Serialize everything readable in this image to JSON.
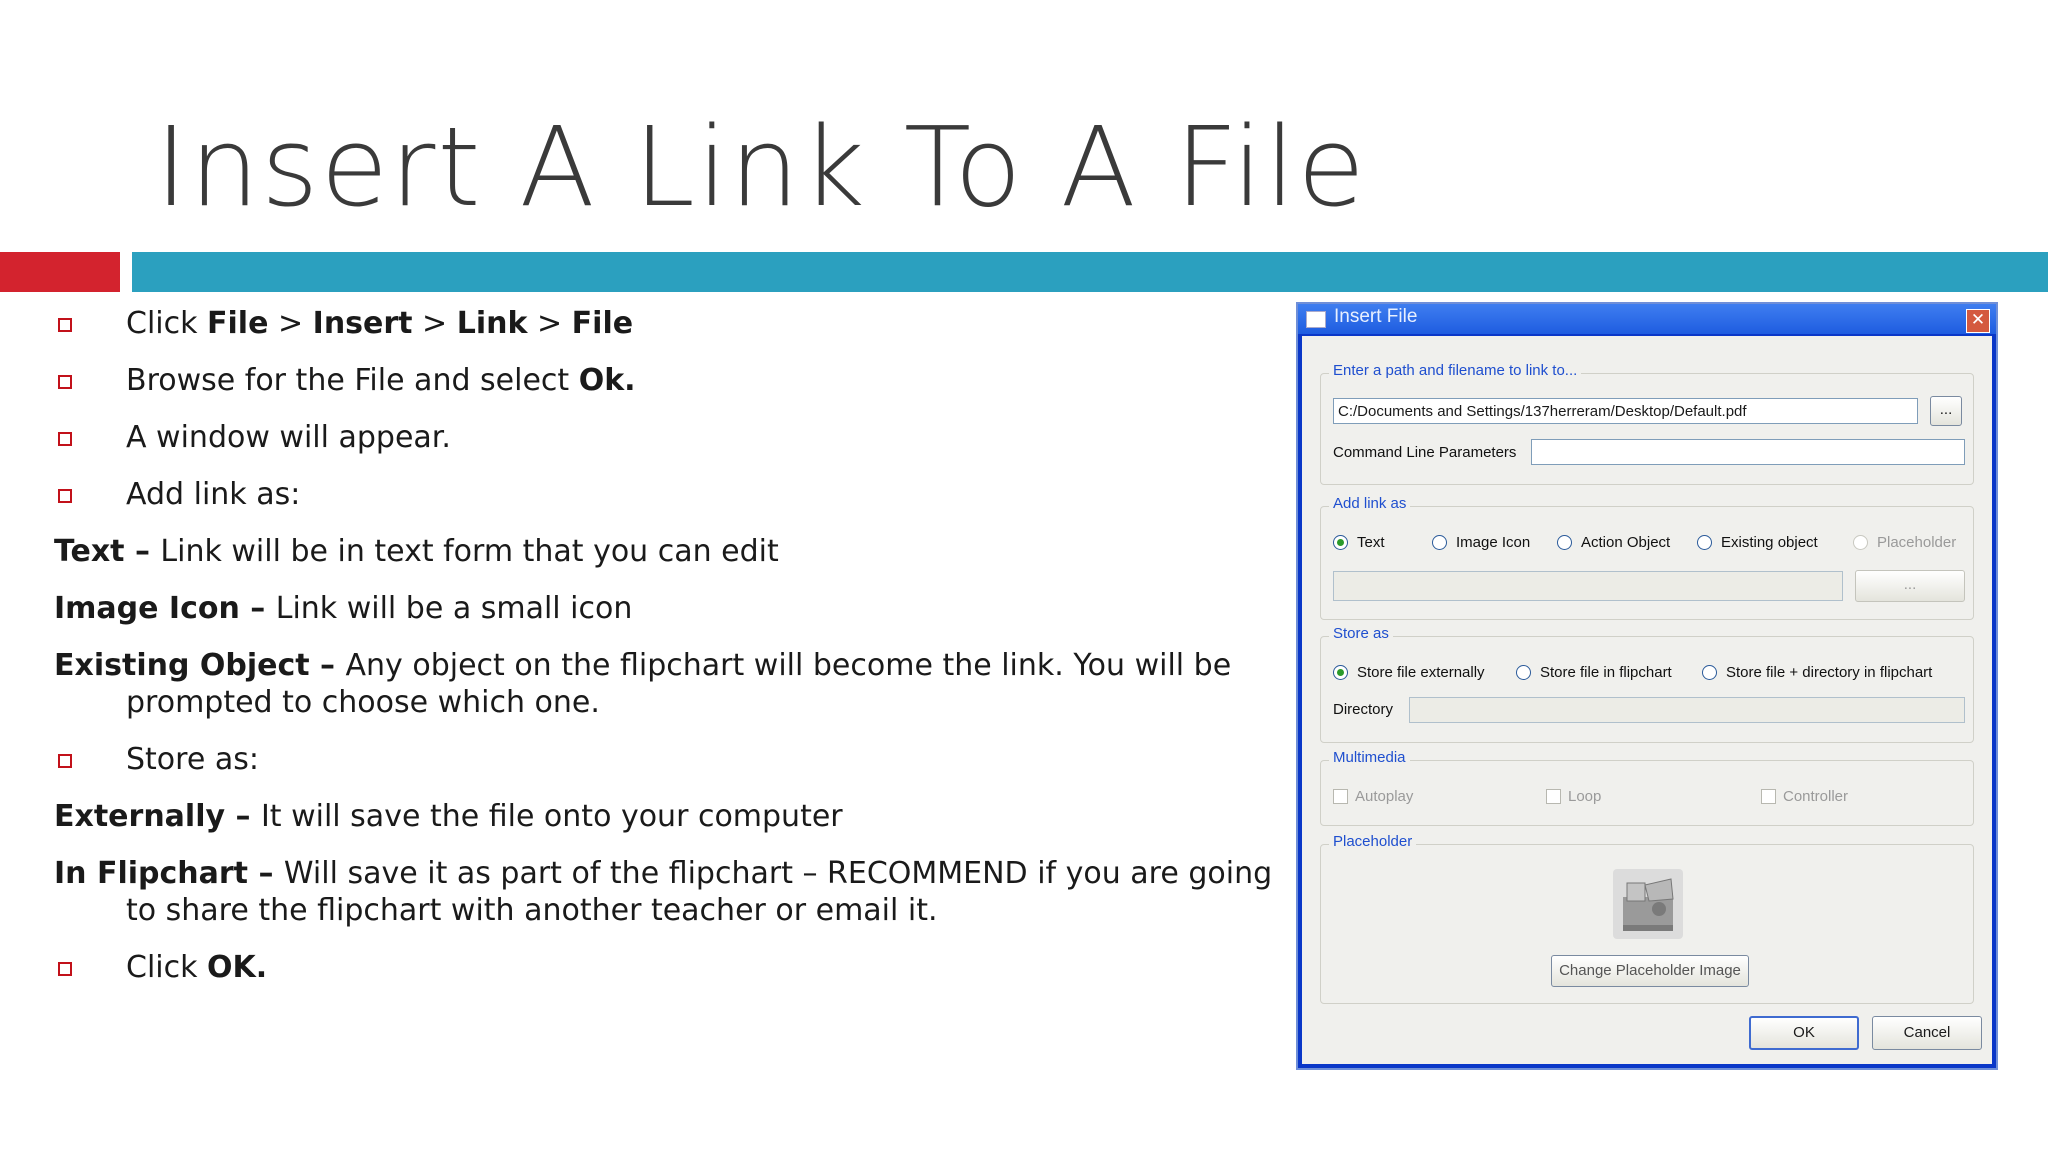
{
  "slide": {
    "title": "Insert A Link To A File",
    "accent_red": "#d3232e",
    "accent_blue": "#2ba0bf"
  },
  "instructions": {
    "step1": {
      "pre": "Click ",
      "b1": "File",
      "s1": " > ",
      "b2": "Insert",
      "s2": " > ",
      "b3": "Link",
      "s3": " > ",
      "b4": "File"
    },
    "step2": {
      "pre": "Browse for the File and select ",
      "b1": "Ok."
    },
    "step3": "A window will appear.",
    "step4": "Add link as:",
    "text_opt": {
      "b": "Text – ",
      "rest": "Link will be in text form that you can edit"
    },
    "icon_opt": {
      "b": "Image Icon – ",
      "rest": "Link will be a small icon"
    },
    "obj_opt": {
      "b": "Existing Object – ",
      "rest": "Any object on the flipchart will become the link.  You will be prompted to choose which one."
    },
    "step5": "Store as:",
    "ext_opt": {
      "b": "Externally – ",
      "rest": "It will save the file onto your computer"
    },
    "flip_opt": {
      "b": "In Flipchart – ",
      "rest": "Will save it as part of the flipchart – RECOMMEND if you are going to share the flipchart with another teacher or email it."
    },
    "step6": {
      "pre": "Click ",
      "b1": "OK."
    }
  },
  "dialog": {
    "title": "Insert File",
    "close": "✕",
    "path_legend": "Enter a path and filename to link to...",
    "path_value": "C:/Documents and Settings/137herreram/Desktop/Default.pdf",
    "browse": "...",
    "cmd_label": "Command Line Parameters",
    "cmd_value": "",
    "linkas_legend": "Add link as",
    "linkas_options": [
      "Text",
      "Image Icon",
      "Action Object",
      "Existing object",
      "Placeholder"
    ],
    "linkas_selected": "Text",
    "linkas_browse": "...",
    "store_legend": "Store as",
    "store_options": [
      "Store file externally",
      "Store file in flipchart",
      "Store file + directory in flipchart"
    ],
    "store_selected": "Store file externally",
    "directory_label": "Directory",
    "directory_value": "",
    "multimedia_legend": "Multimedia",
    "multimedia_options": [
      "Autoplay",
      "Loop",
      "Controller"
    ],
    "placeholder_legend": "Placeholder",
    "change_placeholder": "Change Placeholder Image",
    "ok": "OK",
    "cancel": "Cancel",
    "frame_color": "#0a37c8",
    "legend_color": "#1f4fcf"
  }
}
